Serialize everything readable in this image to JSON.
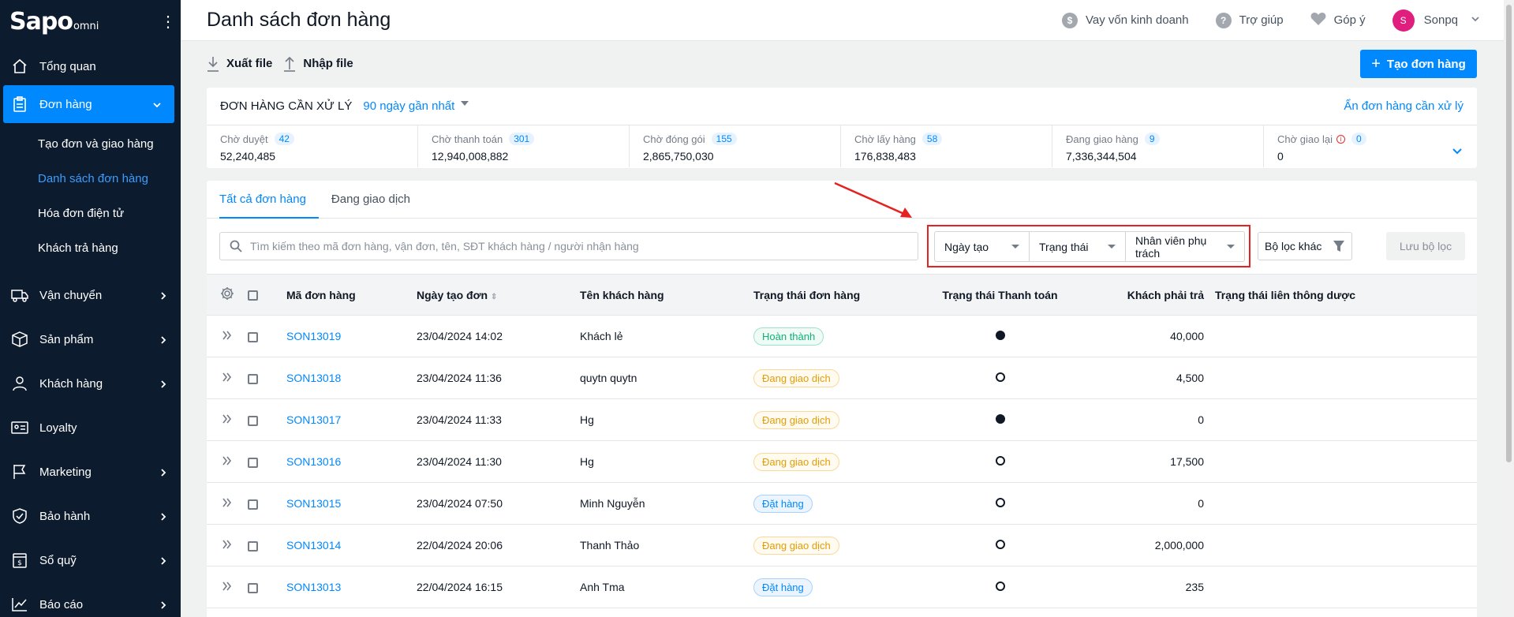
{
  "sidebar": {
    "logo_main": "Sapo",
    "logo_sub": "omni",
    "items": [
      {
        "label": "Tổng quan",
        "icon": "home-icon"
      },
      {
        "label": "Đơn hàng",
        "icon": "clipboard-icon"
      },
      {
        "label": "Vận chuyển",
        "icon": "truck-icon"
      },
      {
        "label": "Sản phẩm",
        "icon": "box-icon"
      },
      {
        "label": "Khách hàng",
        "icon": "user-icon"
      },
      {
        "label": "Loyalty",
        "icon": "loyalty-card-icon"
      },
      {
        "label": "Marketing",
        "icon": "flag-icon"
      },
      {
        "label": "Bảo hành",
        "icon": "shield-check-icon"
      },
      {
        "label": "Sổ quỹ",
        "icon": "ledger-icon"
      },
      {
        "label": "Báo cáo",
        "icon": "chart-line-icon"
      }
    ],
    "sub_items": [
      "Tạo đơn và giao hàng",
      "Danh sách đơn hàng",
      "Hóa đơn điện tử",
      "Khách trả hàng"
    ]
  },
  "header": {
    "title": "Danh sách đơn hàng",
    "loan": "Vay vốn kinh doanh",
    "help": "Trợ giúp",
    "feedback": "Góp ý",
    "user_initial": "S",
    "user_name": "Sonpq"
  },
  "toolbar": {
    "export": "Xuất file",
    "import": "Nhập file",
    "create": "Tạo đơn hàng"
  },
  "pending": {
    "title": "ĐƠN HÀNG CẦN XỬ LÝ",
    "range": "90 ngày gần nhất",
    "hide": "Ẩn đơn hàng cần xử lý",
    "cells": [
      {
        "label": "Chờ duyệt",
        "count": "42",
        "value": "52,240,485"
      },
      {
        "label": "Chờ thanh toán",
        "count": "301",
        "value": "12,940,008,882"
      },
      {
        "label": "Chờ đóng gói",
        "count": "155",
        "value": "2,865,750,030"
      },
      {
        "label": "Chờ lấy hàng",
        "count": "58",
        "value": "176,838,483"
      },
      {
        "label": "Đang giao hàng",
        "count": "9",
        "value": "7,336,344,504"
      },
      {
        "label": "Chờ giao lại",
        "count": "0",
        "value": "0"
      }
    ]
  },
  "tabs": [
    "Tất cả đơn hàng",
    "Đang giao dịch"
  ],
  "filters": {
    "search_placeholder": "Tìm kiếm theo mã đơn hàng, vận đơn, tên, SĐT khách hàng / người nhận hàng",
    "date": "Ngày tạo",
    "status": "Trạng thái",
    "staff": "Nhân viên phụ trách",
    "more": "Bộ lọc khác",
    "save": "Lưu bộ lọc"
  },
  "table": {
    "headers": [
      "Mã đơn hàng",
      "Ngày tạo đơn",
      "Tên khách hàng",
      "Trạng thái đơn hàng",
      "Trạng thái Thanh toán",
      "Khách phải trả",
      "Trạng thái liên thông dược"
    ],
    "rows": [
      {
        "code": "SON13019",
        "date": "23/04/2024 14:02",
        "customer": "Khách lẻ",
        "status": "Hoàn thành",
        "status_type": "done",
        "paid": true,
        "total": "40,000"
      },
      {
        "code": "SON13018",
        "date": "23/04/2024 11:36",
        "customer": "quytn quytn",
        "status": "Đang giao dịch",
        "status_type": "ship",
        "paid": false,
        "total": "4,500"
      },
      {
        "code": "SON13017",
        "date": "23/04/2024 11:33",
        "customer": "Hg",
        "status": "Đang giao dịch",
        "status_type": "ship",
        "paid": true,
        "total": "0"
      },
      {
        "code": "SON13016",
        "date": "23/04/2024 11:30",
        "customer": "Hg",
        "status": "Đang giao dịch",
        "status_type": "ship",
        "paid": false,
        "total": "17,500"
      },
      {
        "code": "SON13015",
        "date": "23/04/2024 07:50",
        "customer": "Minh Nguyễn",
        "status": "Đặt hàng",
        "status_type": "order",
        "paid": false,
        "total": "0"
      },
      {
        "code": "SON13014",
        "date": "22/04/2024 20:06",
        "customer": "Thanh Thảo",
        "status": "Đang giao dịch",
        "status_type": "ship",
        "paid": false,
        "total": "2,000,000"
      },
      {
        "code": "SON13013",
        "date": "22/04/2024 16:15",
        "customer": "Anh Tma",
        "status": "Đặt hàng",
        "status_type": "order",
        "paid": false,
        "total": "235"
      }
    ]
  }
}
